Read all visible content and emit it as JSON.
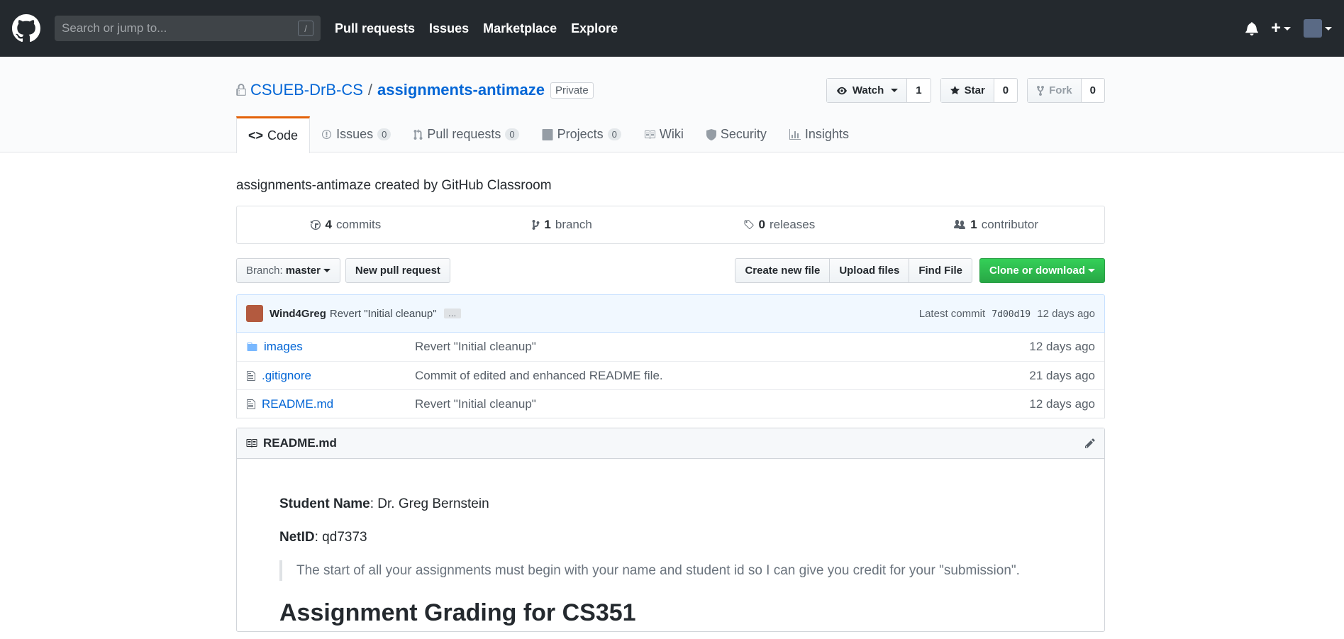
{
  "header": {
    "search_placeholder": "Search or jump to...",
    "slash_key": "/",
    "nav": [
      "Pull requests",
      "Issues",
      "Marketplace",
      "Explore"
    ],
    "plus": "+"
  },
  "repo": {
    "owner": "CSUEB-DrB-CS",
    "separator": "/",
    "name": "assignments-antimaze",
    "visibility": "Private",
    "watch_label": "Watch",
    "watch_count": "1",
    "star_label": "Star",
    "star_count": "0",
    "fork_label": "Fork",
    "fork_count": "0"
  },
  "tabs": {
    "code": "Code",
    "issues": "Issues",
    "issues_count": "0",
    "pulls": "Pull requests",
    "pulls_count": "0",
    "projects": "Projects",
    "projects_count": "0",
    "wiki": "Wiki",
    "security": "Security",
    "insights": "Insights"
  },
  "description": "assignments-antimaze created by GitHub Classroom",
  "summary": {
    "commits_count": "4",
    "commits_label": "commits",
    "branch_count": "1",
    "branch_label": "branch",
    "releases_count": "0",
    "releases_label": "releases",
    "contributor_count": "1",
    "contributor_label": "contributor"
  },
  "filebar": {
    "branch_prefix": "Branch:",
    "branch_name": "master",
    "new_pr": "New pull request",
    "create_file": "Create new file",
    "upload": "Upload files",
    "find": "Find File",
    "clone": "Clone or download"
  },
  "commit": {
    "author": "Wind4Greg",
    "message": "Revert \"Initial cleanup\"",
    "ellipsis": "…",
    "latest_label": "Latest commit",
    "sha": "7d00d19",
    "age": "12 days ago"
  },
  "files": [
    {
      "name": "images",
      "message": "Revert \"Initial cleanup\"",
      "age": "12 days ago",
      "type": "folder"
    },
    {
      "name": ".gitignore",
      "message": "Commit of edited and enhanced README file.",
      "age": "21 days ago",
      "type": "file"
    },
    {
      "name": "README.md",
      "message": "Revert \"Initial cleanup\"",
      "age": "12 days ago",
      "type": "file"
    }
  ],
  "readme": {
    "title": "README.md",
    "student_label": "Student Name",
    "student_value": ": Dr. Greg Bernstein",
    "netid_label": "NetID",
    "netid_value": ": qd7373",
    "quote": "The start of all your assignments must begin with your name and student id so I can give you credit for your \"submission\".",
    "heading": "Assignment Grading for CS351"
  },
  "colors": {
    "header_bg": "#24292e",
    "link": "#0366d6",
    "tab_accent": "#e36209",
    "clone_green": "#28a745"
  }
}
